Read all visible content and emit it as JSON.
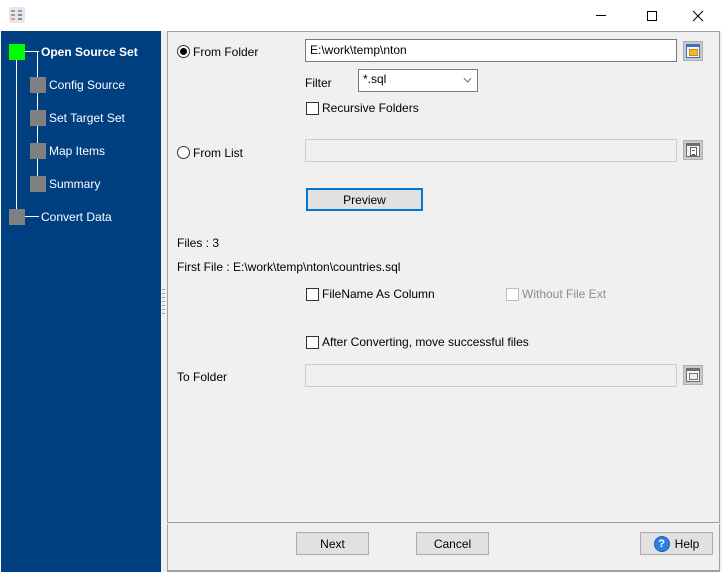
{
  "window": {
    "icon": "app-grid-icon",
    "controls": {
      "minimize": "minimize-icon",
      "maximize": "maximize-icon",
      "close": "close-icon"
    }
  },
  "sidebar": {
    "steps": [
      {
        "label": "Open Source Set",
        "active": true,
        "level": 0
      },
      {
        "label": "Config Source",
        "active": false,
        "level": 1
      },
      {
        "label": "Set Target Set",
        "active": false,
        "level": 1
      },
      {
        "label": "Map Items",
        "active": false,
        "level": 1
      },
      {
        "label": "Summary",
        "active": false,
        "level": 1
      },
      {
        "label": "Convert Data",
        "active": false,
        "level": 0
      }
    ],
    "colors": {
      "background": "#003f80",
      "active_step": "#00ff00",
      "inactive_step": "#808080"
    }
  },
  "source": {
    "from_folder_label": "From Folder",
    "from_folder_selected": true,
    "folder_path": "E:\\work\\temp\\nton",
    "filter_label": "Filter",
    "filter_value": "*.sql",
    "recursive_label": "Recursive Folders",
    "recursive_checked": false,
    "from_list_label": "From List",
    "from_list_selected": false,
    "list_path": "",
    "preview_label": "Preview"
  },
  "info": {
    "files_text": "Files : 3",
    "first_file_text": "First File : E:\\work\\temp\\nton\\countries.sql"
  },
  "options": {
    "filename_as_column_label": "FileName As Column",
    "filename_as_column_checked": false,
    "without_file_ext_label": "Without File Ext",
    "without_file_ext_enabled": false,
    "move_after_label": "After Converting, move successful files",
    "move_after_checked": false,
    "to_folder_label": "To Folder",
    "to_folder_value": ""
  },
  "footer": {
    "next_label": "Next",
    "cancel_label": "Cancel",
    "help_label": "Help",
    "help_icon_glyph": "?"
  }
}
